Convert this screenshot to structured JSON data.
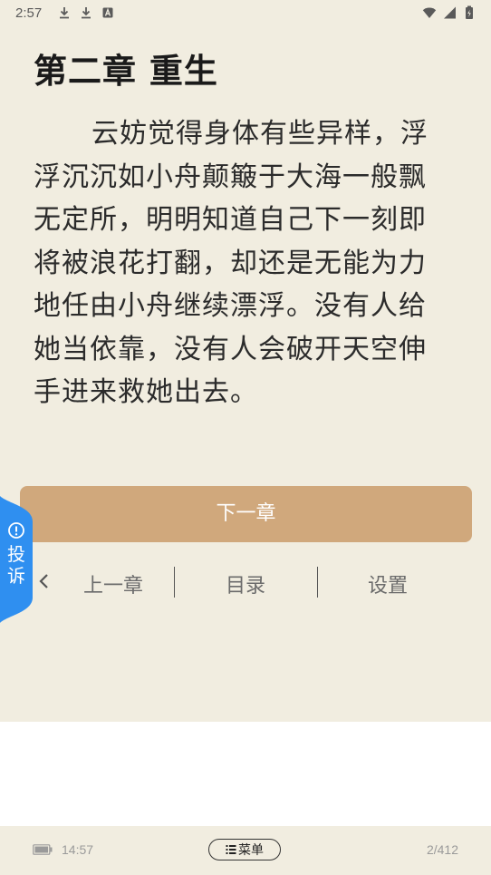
{
  "status_bar": {
    "time": "2:57",
    "left_icons": [
      "download-icon",
      "download-icon",
      "app-notification-icon"
    ],
    "right_icons": [
      "wifi-icon",
      "signal-icon",
      "battery-charging-icon"
    ]
  },
  "chapter": {
    "title": "第二章 重生",
    "body": "云妨觉得身体有些异样，浮浮沉沉如小舟颠簸于大海一般飘无定所，明明知道自己下一刻即将被浪花打翻，却还是无能为力地任由小舟继续漂浮。没有人给她当依靠，没有人会破开天空伸手进来救她出去。"
  },
  "next_chapter_label": "下一章",
  "nav": {
    "back_icon": "chevron-left-icon",
    "prev_label": "上一章",
    "toc_label": "目录",
    "settings_label": "设置"
  },
  "complain": {
    "icon": "alert-circle-icon",
    "label": "投诉"
  },
  "footer": {
    "battery_icon": "battery-icon",
    "time": "14:57",
    "menu_label": "菜单",
    "menu_icon": "list-icon",
    "page_indicator": "2/412"
  },
  "colors": {
    "page_background": "#f1ede0",
    "next_button": "#d0a87c",
    "complain_tab": "#2f8ff0"
  }
}
